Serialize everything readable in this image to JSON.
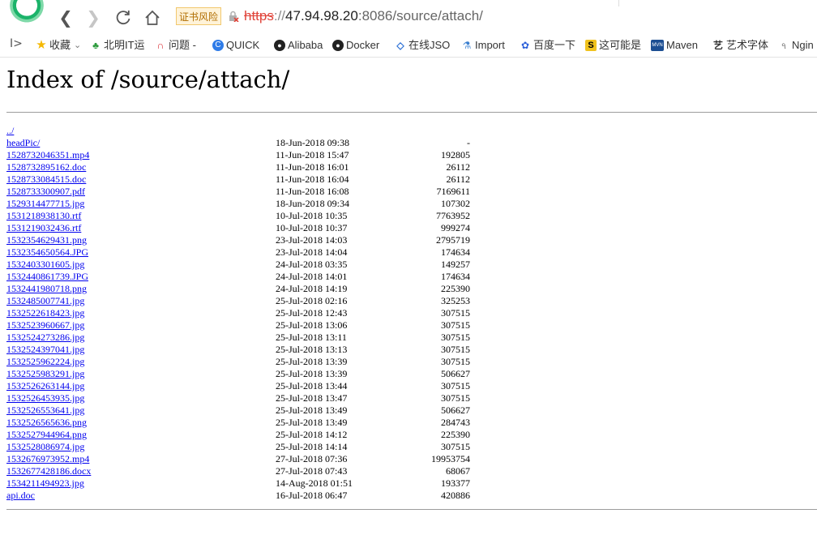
{
  "browser": {
    "cert_badge": "证书风险",
    "url": {
      "protocol": "https",
      "sep": "://",
      "host": "47.94.98.20",
      "port": ":8086",
      "path": "/source/attach/"
    },
    "bookmarks_toggle": "I>",
    "bookmarks": [
      {
        "label": "收藏",
        "icon": "star-icon",
        "chevron": "⌄"
      },
      {
        "label": "北明IT运",
        "icon": "leaf-icon"
      },
      {
        "label": "问题 -",
        "icon": "arc-icon"
      },
      {
        "label": "QUICK",
        "icon": "globe-icon"
      },
      {
        "label": "Alibaba",
        "icon": "github-icon"
      },
      {
        "label": "Docker",
        "icon": "github-icon"
      },
      {
        "label": "在线JSO",
        "icon": "code-icon"
      },
      {
        "label": "Import",
        "icon": "flask-icon"
      },
      {
        "label": "百度一下",
        "icon": "paw-icon"
      },
      {
        "label": "这可能是",
        "icon": "s-icon"
      },
      {
        "label": "Maven",
        "icon": "mvn-icon"
      },
      {
        "label": "艺术字体",
        "icon": "brush-icon"
      },
      {
        "label": "Ngin",
        "icon": "tool-icon"
      }
    ]
  },
  "page": {
    "title": "Index of /source/attach/",
    "parent_link": "../",
    "entries": [
      {
        "name": "headPic/",
        "date": "18-Jun-2018 09:38",
        "size": "-"
      },
      {
        "name": "1528732046351.mp4",
        "date": "11-Jun-2018 15:47",
        "size": "192805"
      },
      {
        "name": "1528732895162.doc",
        "date": "11-Jun-2018 16:01",
        "size": "26112"
      },
      {
        "name": "1528733084515.doc",
        "date": "11-Jun-2018 16:04",
        "size": "26112"
      },
      {
        "name": "1528733300907.pdf",
        "date": "11-Jun-2018 16:08",
        "size": "7169611"
      },
      {
        "name": "1529314477715.jpg",
        "date": "18-Jun-2018 09:34",
        "size": "107302"
      },
      {
        "name": "1531218938130.rtf",
        "date": "10-Jul-2018 10:35",
        "size": "7763952"
      },
      {
        "name": "1531219032436.rtf",
        "date": "10-Jul-2018 10:37",
        "size": "999274"
      },
      {
        "name": "1532354629431.png",
        "date": "23-Jul-2018 14:03",
        "size": "2795719"
      },
      {
        "name": "1532354650564.JPG",
        "date": "23-Jul-2018 14:04",
        "size": "174634"
      },
      {
        "name": "1532403301605.jpg",
        "date": "24-Jul-2018 03:35",
        "size": "149257"
      },
      {
        "name": "1532440861739.JPG",
        "date": "24-Jul-2018 14:01",
        "size": "174634"
      },
      {
        "name": "1532441980718.png",
        "date": "24-Jul-2018 14:19",
        "size": "225390"
      },
      {
        "name": "1532485007741.jpg",
        "date": "25-Jul-2018 02:16",
        "size": "325253"
      },
      {
        "name": "1532522618423.jpg",
        "date": "25-Jul-2018 12:43",
        "size": "307515"
      },
      {
        "name": "1532523960667.jpg",
        "date": "25-Jul-2018 13:06",
        "size": "307515"
      },
      {
        "name": "1532524273286.jpg",
        "date": "25-Jul-2018 13:11",
        "size": "307515"
      },
      {
        "name": "1532524397041.jpg",
        "date": "25-Jul-2018 13:13",
        "size": "307515"
      },
      {
        "name": "1532525962224.jpg",
        "date": "25-Jul-2018 13:39",
        "size": "307515"
      },
      {
        "name": "1532525983291.jpg",
        "date": "25-Jul-2018 13:39",
        "size": "506627"
      },
      {
        "name": "1532526263144.jpg",
        "date": "25-Jul-2018 13:44",
        "size": "307515"
      },
      {
        "name": "1532526453935.jpg",
        "date": "25-Jul-2018 13:47",
        "size": "307515"
      },
      {
        "name": "1532526553641.jpg",
        "date": "25-Jul-2018 13:49",
        "size": "506627"
      },
      {
        "name": "1532526565636.png",
        "date": "25-Jul-2018 13:49",
        "size": "284743"
      },
      {
        "name": "1532527944964.png",
        "date": "25-Jul-2018 14:12",
        "size": "225390"
      },
      {
        "name": "1532528086974.jpg",
        "date": "25-Jul-2018 14:14",
        "size": "307515"
      },
      {
        "name": "1532676973952.mp4",
        "date": "27-Jul-2018 07:36",
        "size": "19953754"
      },
      {
        "name": "1532677428186.docx",
        "date": "27-Jul-2018 07:43",
        "size": "68067"
      },
      {
        "name": "1534211494923.jpg",
        "date": "14-Aug-2018 01:51",
        "size": "193377"
      },
      {
        "name": "api.doc",
        "date": "16-Jul-2018 06:47",
        "size": "420886"
      }
    ]
  }
}
